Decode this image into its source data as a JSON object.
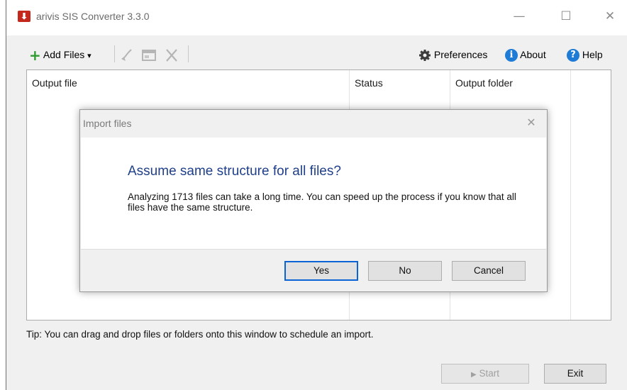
{
  "window": {
    "title": "arivis SIS Converter  3.3.0",
    "controls": {
      "minimize": "—",
      "maximize": "☐",
      "close": "✕"
    }
  },
  "toolbar": {
    "add_files_label": "Add Files",
    "dropdown_glyph": "▾",
    "preferences_label": "Preferences",
    "about_label": "About",
    "help_label": "Help",
    "icons": [
      "plus-icon",
      "broom-icon",
      "window-icon",
      "remove-icon",
      "gear-icon",
      "info-icon",
      "help-icon"
    ]
  },
  "table": {
    "columns": [
      "Output file",
      "Status",
      "Output folder"
    ]
  },
  "tip": "Tip: You can drag and drop files or folders onto this window to schedule an import.",
  "footer": {
    "start_label": "Start",
    "exit_label": "Exit"
  },
  "dialog": {
    "title": "Import files",
    "heading": "Assume same structure for all files?",
    "message": "Analyzing 1713 files can take a long time. You can speed up the process if you know that all files have the same structure.",
    "yes_label": "Yes",
    "no_label": "No",
    "cancel_label": "Cancel"
  },
  "colors": {
    "accent": "#0a64d6",
    "heading": "#1f3f8a",
    "add_icon": "#2e9b2e",
    "info_icon": "#1e7bd6"
  }
}
